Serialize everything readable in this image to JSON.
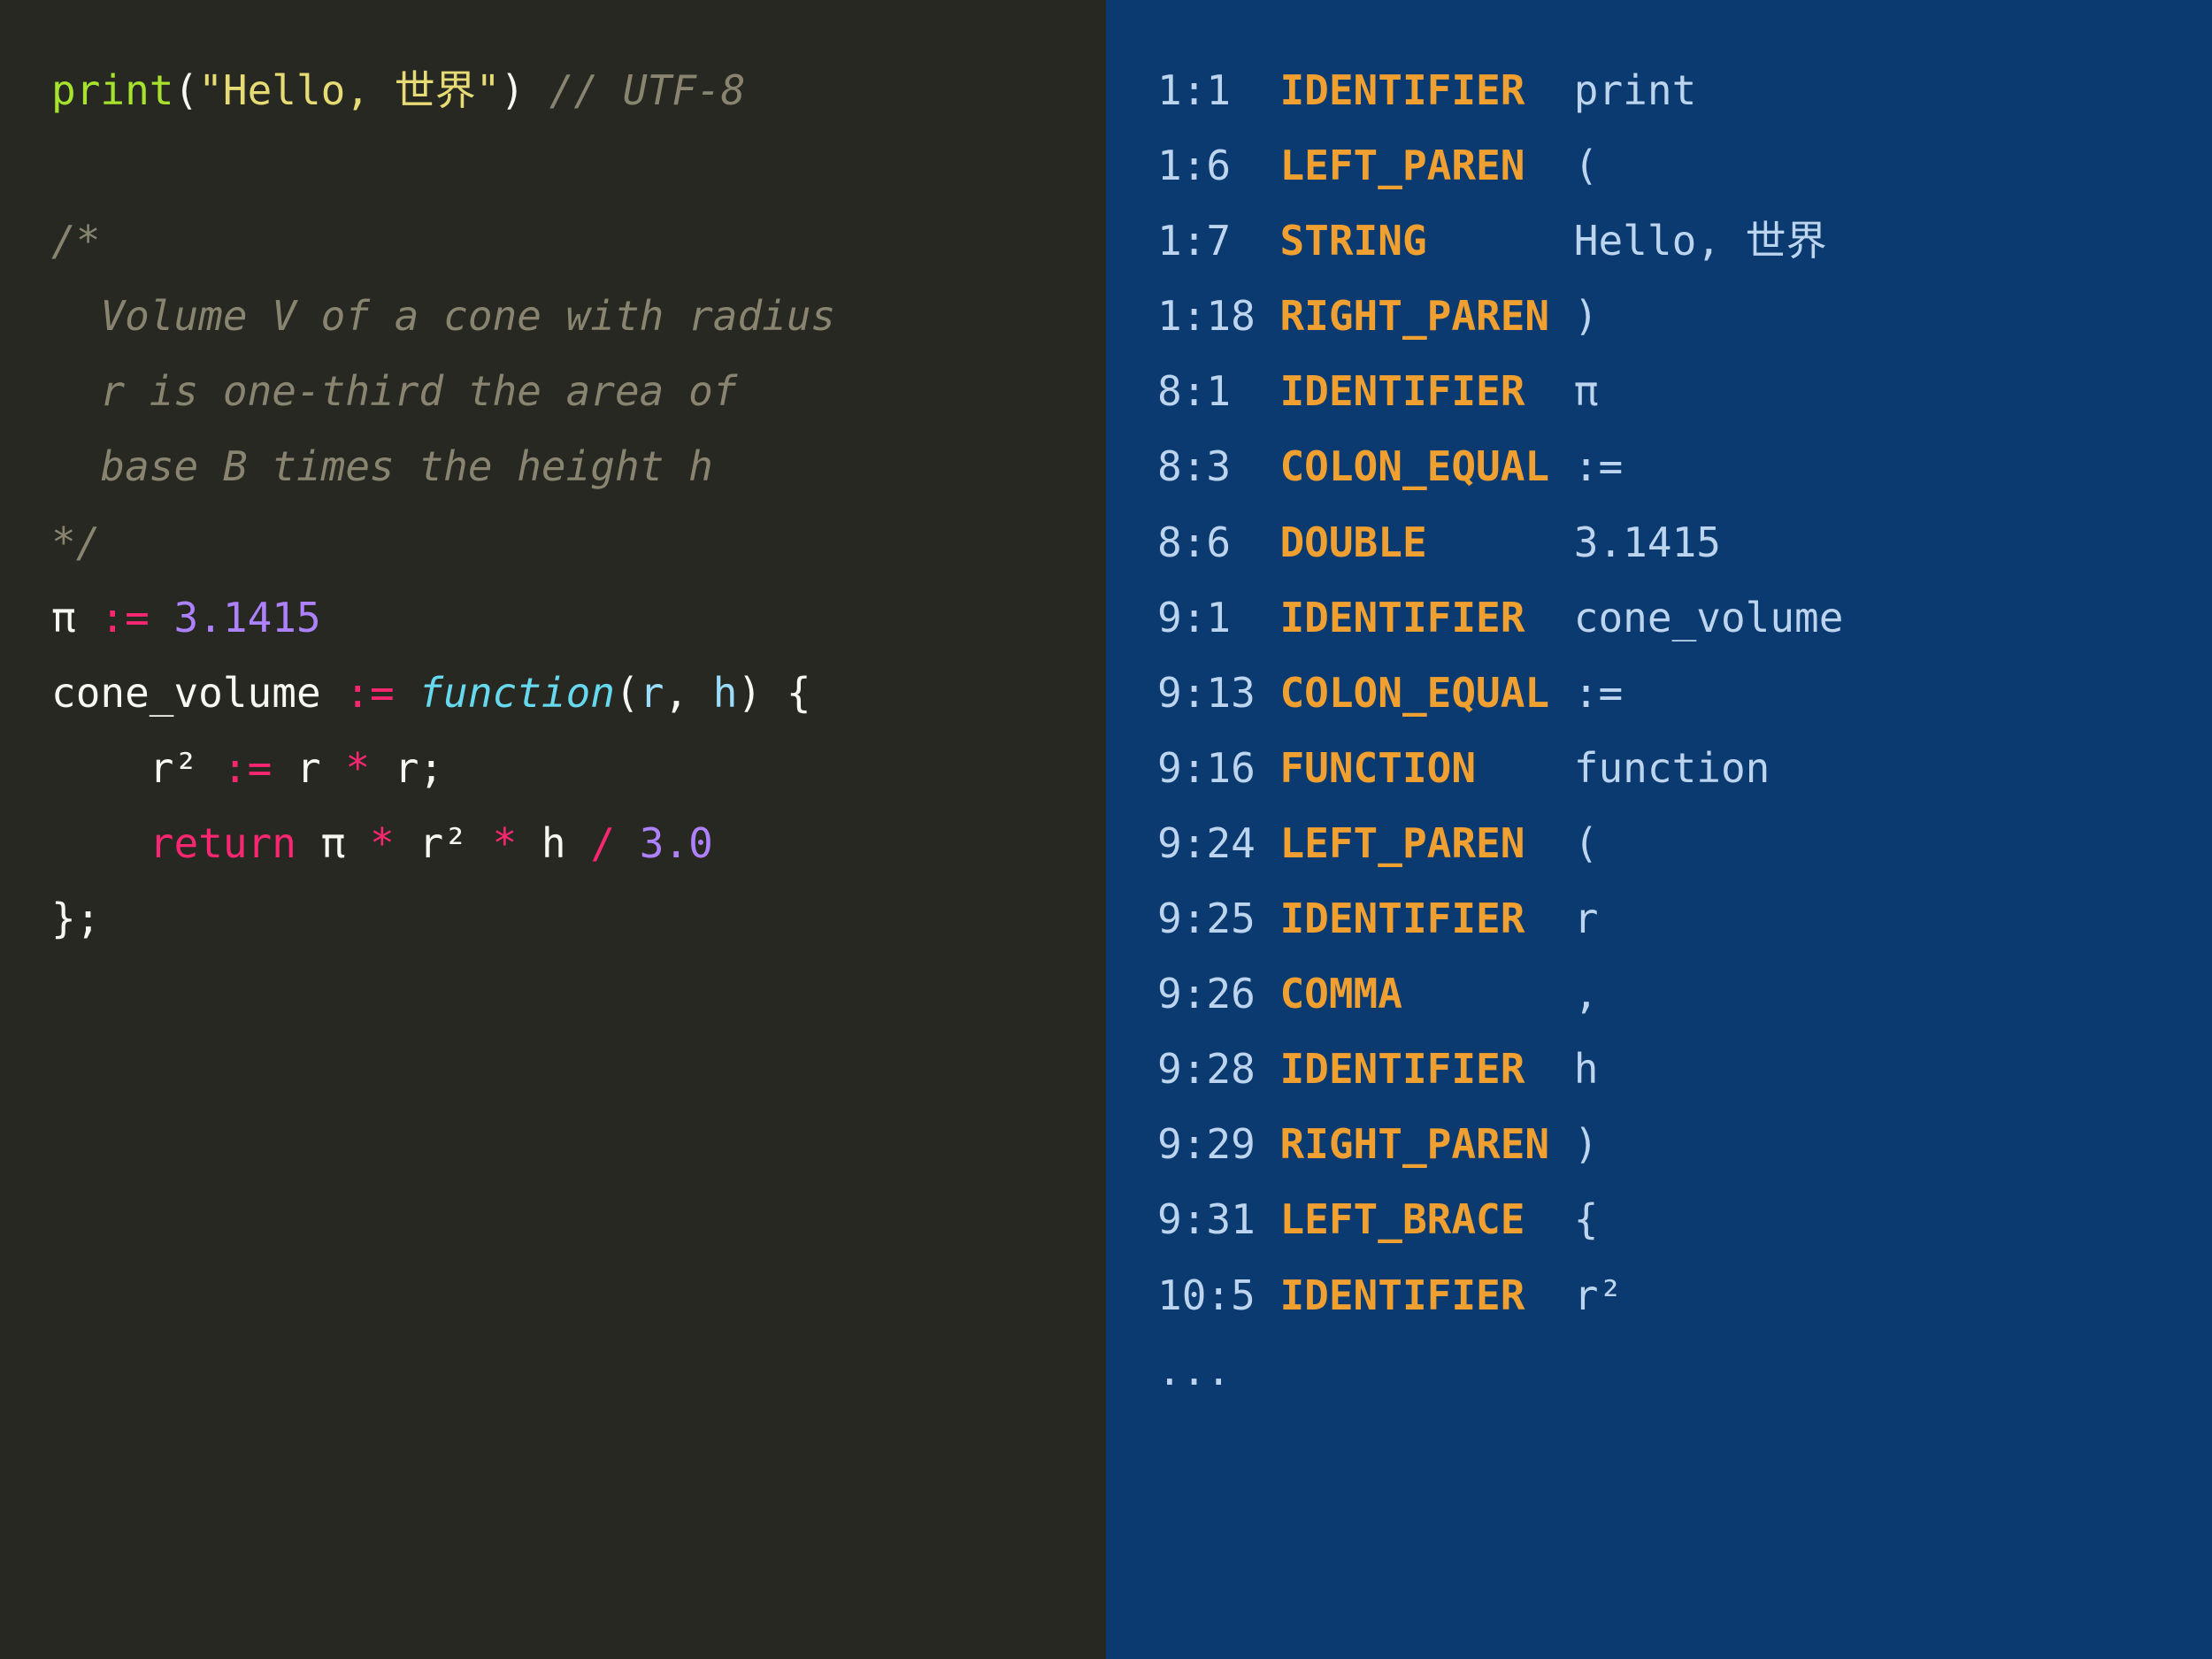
{
  "code_lines": [
    [
      {
        "cls": "c-fn",
        "t": "print"
      },
      {
        "cls": "c-paren",
        "t": "("
      },
      {
        "cls": "c-str",
        "t": "\"Hello, 世界\""
      },
      {
        "cls": "c-paren",
        "t": ")"
      },
      {
        "cls": "",
        "t": " "
      },
      {
        "cls": "c-cmt",
        "t": "// UTF-8"
      }
    ],
    [],
    [
      {
        "cls": "c-cmt",
        "t": "/*"
      }
    ],
    [
      {
        "cls": "c-cmt",
        "t": "  Volume "
      },
      {
        "cls": "c-cmt-em",
        "t": "V"
      },
      {
        "cls": "c-cmt",
        "t": " of a cone with radius"
      }
    ],
    [
      {
        "cls": "c-cmt",
        "t": "  "
      },
      {
        "cls": "c-cmt-em",
        "t": "r"
      },
      {
        "cls": "c-cmt",
        "t": " is one-third the area of"
      }
    ],
    [
      {
        "cls": "c-cmt",
        "t": "  base "
      },
      {
        "cls": "c-cmt-em",
        "t": "B"
      },
      {
        "cls": "c-cmt",
        "t": " times the height "
      },
      {
        "cls": "c-cmt-em",
        "t": "h"
      }
    ],
    [
      {
        "cls": "c-cmt",
        "t": "*/"
      }
    ],
    [
      {
        "cls": "c-ident",
        "t": "π "
      },
      {
        "cls": "c-op",
        "t": ":="
      },
      {
        "cls": "c-ident",
        "t": " "
      },
      {
        "cls": "c-num",
        "t": "3.1415"
      }
    ],
    [
      {
        "cls": "c-ident",
        "t": "cone_volume "
      },
      {
        "cls": "c-op",
        "t": ":="
      },
      {
        "cls": "c-ident",
        "t": " "
      },
      {
        "cls": "c-kw",
        "t": "function"
      },
      {
        "cls": "c-paren",
        "t": "("
      },
      {
        "cls": "c-ident-lt",
        "t": "r"
      },
      {
        "cls": "c-paren",
        "t": ", "
      },
      {
        "cls": "c-ident-lt",
        "t": "h"
      },
      {
        "cls": "c-paren",
        "t": ") {"
      }
    ],
    [
      {
        "cls": "c-ident",
        "t": "    r² "
      },
      {
        "cls": "c-op",
        "t": ":="
      },
      {
        "cls": "c-ident",
        "t": " r "
      },
      {
        "cls": "c-op",
        "t": "*"
      },
      {
        "cls": "c-ident",
        "t": " r"
      },
      {
        "cls": "c-paren",
        "t": ";"
      }
    ],
    [
      {
        "cls": "",
        "t": "    "
      },
      {
        "cls": "c-kw2",
        "t": "return"
      },
      {
        "cls": "c-ident",
        "t": " π "
      },
      {
        "cls": "c-op",
        "t": "*"
      },
      {
        "cls": "c-ident",
        "t": " r² "
      },
      {
        "cls": "c-op",
        "t": "*"
      },
      {
        "cls": "c-ident",
        "t": " h "
      },
      {
        "cls": "c-op",
        "t": "/"
      },
      {
        "cls": "c-ident",
        "t": " "
      },
      {
        "cls": "c-num",
        "t": "3.0"
      }
    ],
    [
      {
        "cls": "c-paren",
        "t": "};"
      }
    ]
  ],
  "tokens": [
    {
      "pos": "1:1",
      "type": "IDENTIFIER",
      "lex": "print"
    },
    {
      "pos": "1:6",
      "type": "LEFT_PAREN",
      "lex": "("
    },
    {
      "pos": "1:7",
      "type": "STRING",
      "lex": "Hello, 世界"
    },
    {
      "pos": "1:18",
      "type": "RIGHT_PAREN",
      "lex": ")"
    },
    {
      "pos": "8:1",
      "type": "IDENTIFIER",
      "lex": "π"
    },
    {
      "pos": "8:3",
      "type": "COLON_EQUAL",
      "lex": ":="
    },
    {
      "pos": "8:6",
      "type": "DOUBLE",
      "lex": "3.1415"
    },
    {
      "pos": "9:1",
      "type": "IDENTIFIER",
      "lex": "cone_volume"
    },
    {
      "pos": "9:13",
      "type": "COLON_EQUAL",
      "lex": ":="
    },
    {
      "pos": "9:16",
      "type": "FUNCTION",
      "lex": "function"
    },
    {
      "pos": "9:24",
      "type": "LEFT_PAREN",
      "lex": "("
    },
    {
      "pos": "9:25",
      "type": "IDENTIFIER",
      "lex": "r"
    },
    {
      "pos": "9:26",
      "type": "COMMA",
      "lex": ","
    },
    {
      "pos": "9:28",
      "type": "IDENTIFIER",
      "lex": "h"
    },
    {
      "pos": "9:29",
      "type": "RIGHT_PAREN",
      "lex": ")"
    },
    {
      "pos": "9:31",
      "type": "LEFT_BRACE",
      "lex": "{"
    },
    {
      "pos": "10:5",
      "type": "IDENTIFIER",
      "lex": "r²"
    }
  ],
  "ellipsis": "..."
}
